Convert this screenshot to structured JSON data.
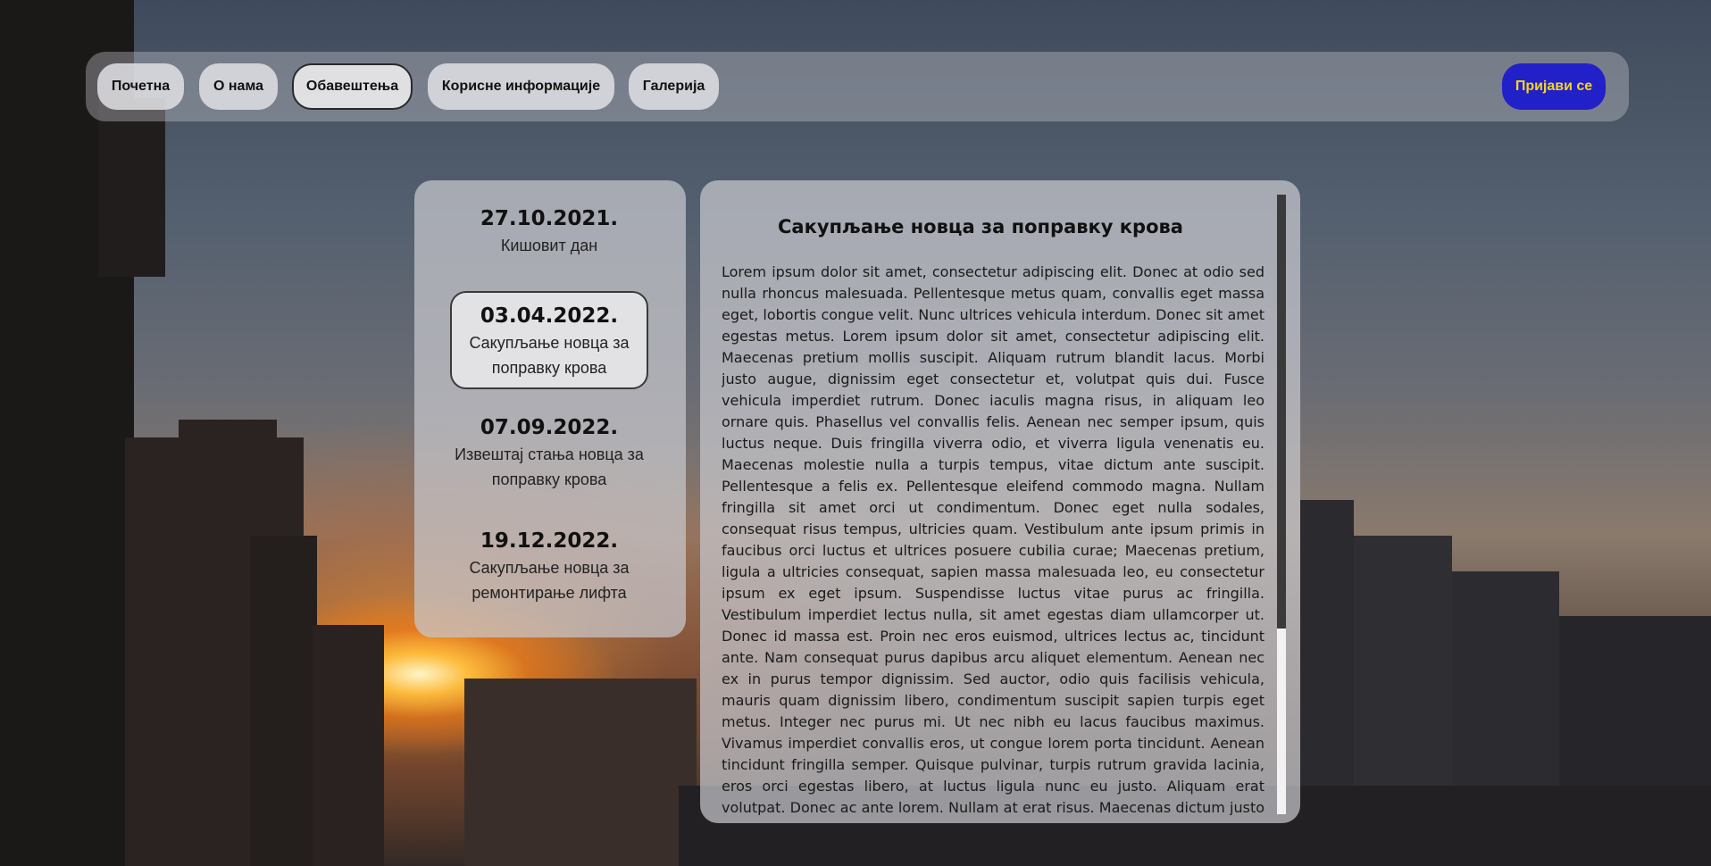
{
  "nav": {
    "items": [
      {
        "label": "Почетна"
      },
      {
        "label": "О нама"
      },
      {
        "label": "Обавештења"
      },
      {
        "label": "Корисне информације"
      },
      {
        "label": "Галерија"
      }
    ],
    "active": "Обавештења",
    "login_label": "Пријави се"
  },
  "notices": [
    {
      "date": "27.10.2021.",
      "title": "Кишовит дан"
    },
    {
      "date": "03.04.2022.",
      "title": "Сакупљање новца за поправку крова"
    },
    {
      "date": "07.09.2022.",
      "title": "Извештај стања новца за поправку крова"
    },
    {
      "date": "19.12.2022.",
      "title": "Сакупљање новца за ремонтирање лифта"
    }
  ],
  "selected_notice": "03.04.2022.",
  "article": {
    "title": "Сакупљање новца за поправку крова",
    "body": "Lorem ipsum dolor sit amet, consectetur adipiscing elit. Donec at odio sed nulla rhoncus malesuada. Pellentesque metus quam, convallis eget massa eget, lobortis congue velit. Nunc ultrices vehicula interdum. Donec sit amet egestas metus. Lorem ipsum dolor sit amet, consectetur adipiscing elit. Maecenas pretium mollis suscipit. Aliquam rutrum blandit lacus. Morbi justo augue, dignissim eget consectetur et, volutpat quis dui. Fusce vehicula imperdiet rutrum. Donec iaculis magna risus, in aliquam leo ornare quis. Phasellus vel convallis felis. Aenean nec semper ipsum, quis luctus neque. Duis fringilla viverra odio, et viverra ligula venenatis eu. Maecenas molestie nulla a turpis tempus, vitae dictum ante suscipit. Pellentesque a felis ex. Pellentesque eleifend commodo magna. Nullam fringilla sit amet orci ut condimentum. Donec eget nulla sodales, consequat risus tempus, ultricies quam. Vestibulum ante ipsum primis in faucibus orci luctus et ultrices posuere cubilia curae; Maecenas pretium, ligula a ultricies consequat, sapien massa malesuada leo, eu consectetur ipsum ex eget ipsum. Suspendisse luctus vitae purus ac fringilla. Vestibulum imperdiet lectus nulla, sit amet egestas diam ullamcorper ut. Donec id massa est. Proin nec eros euismod, ultrices lectus ac, tincidunt ante. Nam consequat purus dapibus arcu aliquet elementum. Aenean nec ex in purus tempor dignissim. Sed auctor, odio quis facilisis vehicula, mauris quam dignissim libero, condimentum suscipit sapien turpis eget metus. Integer nec purus mi. Ut nec nibh eu lacus faucibus maximus. Vivamus imperdiet convallis eros, ut congue lorem porta tincidunt. Aenean tincidunt fringilla semper. Quisque pulvinar, turpis rutrum gravida lacinia, eros orci egestas libero, at luctus ligula nunc eu justo. Aliquam erat volutpat. Donec ac ante lorem. Nullam at erat risus. Maecenas dictum justo ac sem venenatis mollis. Vivamus vel euismod turpis, id vestibulum neque. In hac habitasse platea dictumst. Sed rutrum orci vitae metus suscipit efficitur. Orci"
  },
  "colors": {
    "login_bg": "#2220c8",
    "login_text": "#f3d620",
    "scroll_thumb": "#3a3a3a"
  }
}
